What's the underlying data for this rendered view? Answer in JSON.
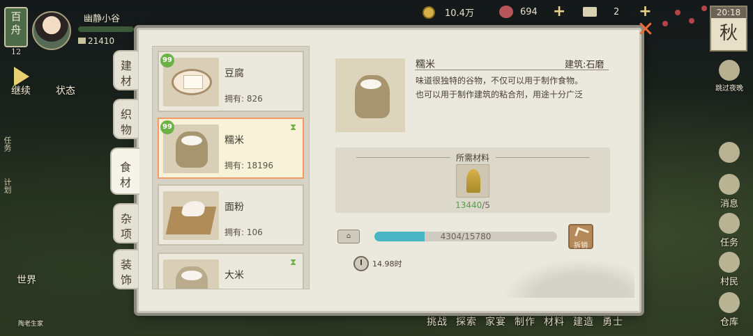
{
  "hud": {
    "region": "百舟",
    "level": "12",
    "player_name": "幽静小谷",
    "small_coins": "21410",
    "coins": "10.4万",
    "gems": "694",
    "tickets": "2",
    "time": "20:18",
    "season": "秋",
    "continue_label": "继续",
    "status_label": "状态",
    "side_tasks": "任务",
    "side_plan": "计划",
    "world_label": "世界",
    "bottom_left_label": "陶老生家",
    "skip_night_label": "跳过夜晚",
    "right_buttons": [
      "消息",
      "任务",
      "村民",
      "仓库"
    ],
    "bottom_nav": [
      "挑战",
      "探索",
      "家宴",
      "制作",
      "材料",
      "建造",
      "勇士"
    ]
  },
  "modal": {
    "tabs": [
      "建材",
      "织物",
      "食材",
      "杂项",
      "装饰"
    ],
    "active_tab": "食材",
    "items": [
      {
        "name": "豆腐",
        "own": "拥有: 826",
        "badge": "99",
        "hourglass": false
      },
      {
        "name": "糯米",
        "own": "拥有: 18196",
        "badge": "99",
        "hourglass": true
      },
      {
        "name": "面粉",
        "own": "拥有: 106",
        "badge": "",
        "hourglass": false
      },
      {
        "name": "大米",
        "own": "",
        "badge": "",
        "hourglass": true
      }
    ],
    "detail": {
      "name": "糯米",
      "building": "建筑:石磨",
      "desc_line1": "味道很独特的谷物，不仅可以用于制作食物。",
      "desc_line2": "也可以用于制作建筑的粘合剂，用途十分广泛"
    },
    "requirements": {
      "title": "所需材料",
      "have": "13440",
      "need": "/5"
    },
    "progress": {
      "text": "4304/15780",
      "fraction": 0.273
    },
    "dismantle_label": "拆销",
    "time_text": "14.98时"
  },
  "colors": {
    "accent_orange": "#f09a64",
    "progress_teal": "#4ab6c4",
    "badge_green": "#6db046",
    "close_orange": "#ef6a3a"
  }
}
